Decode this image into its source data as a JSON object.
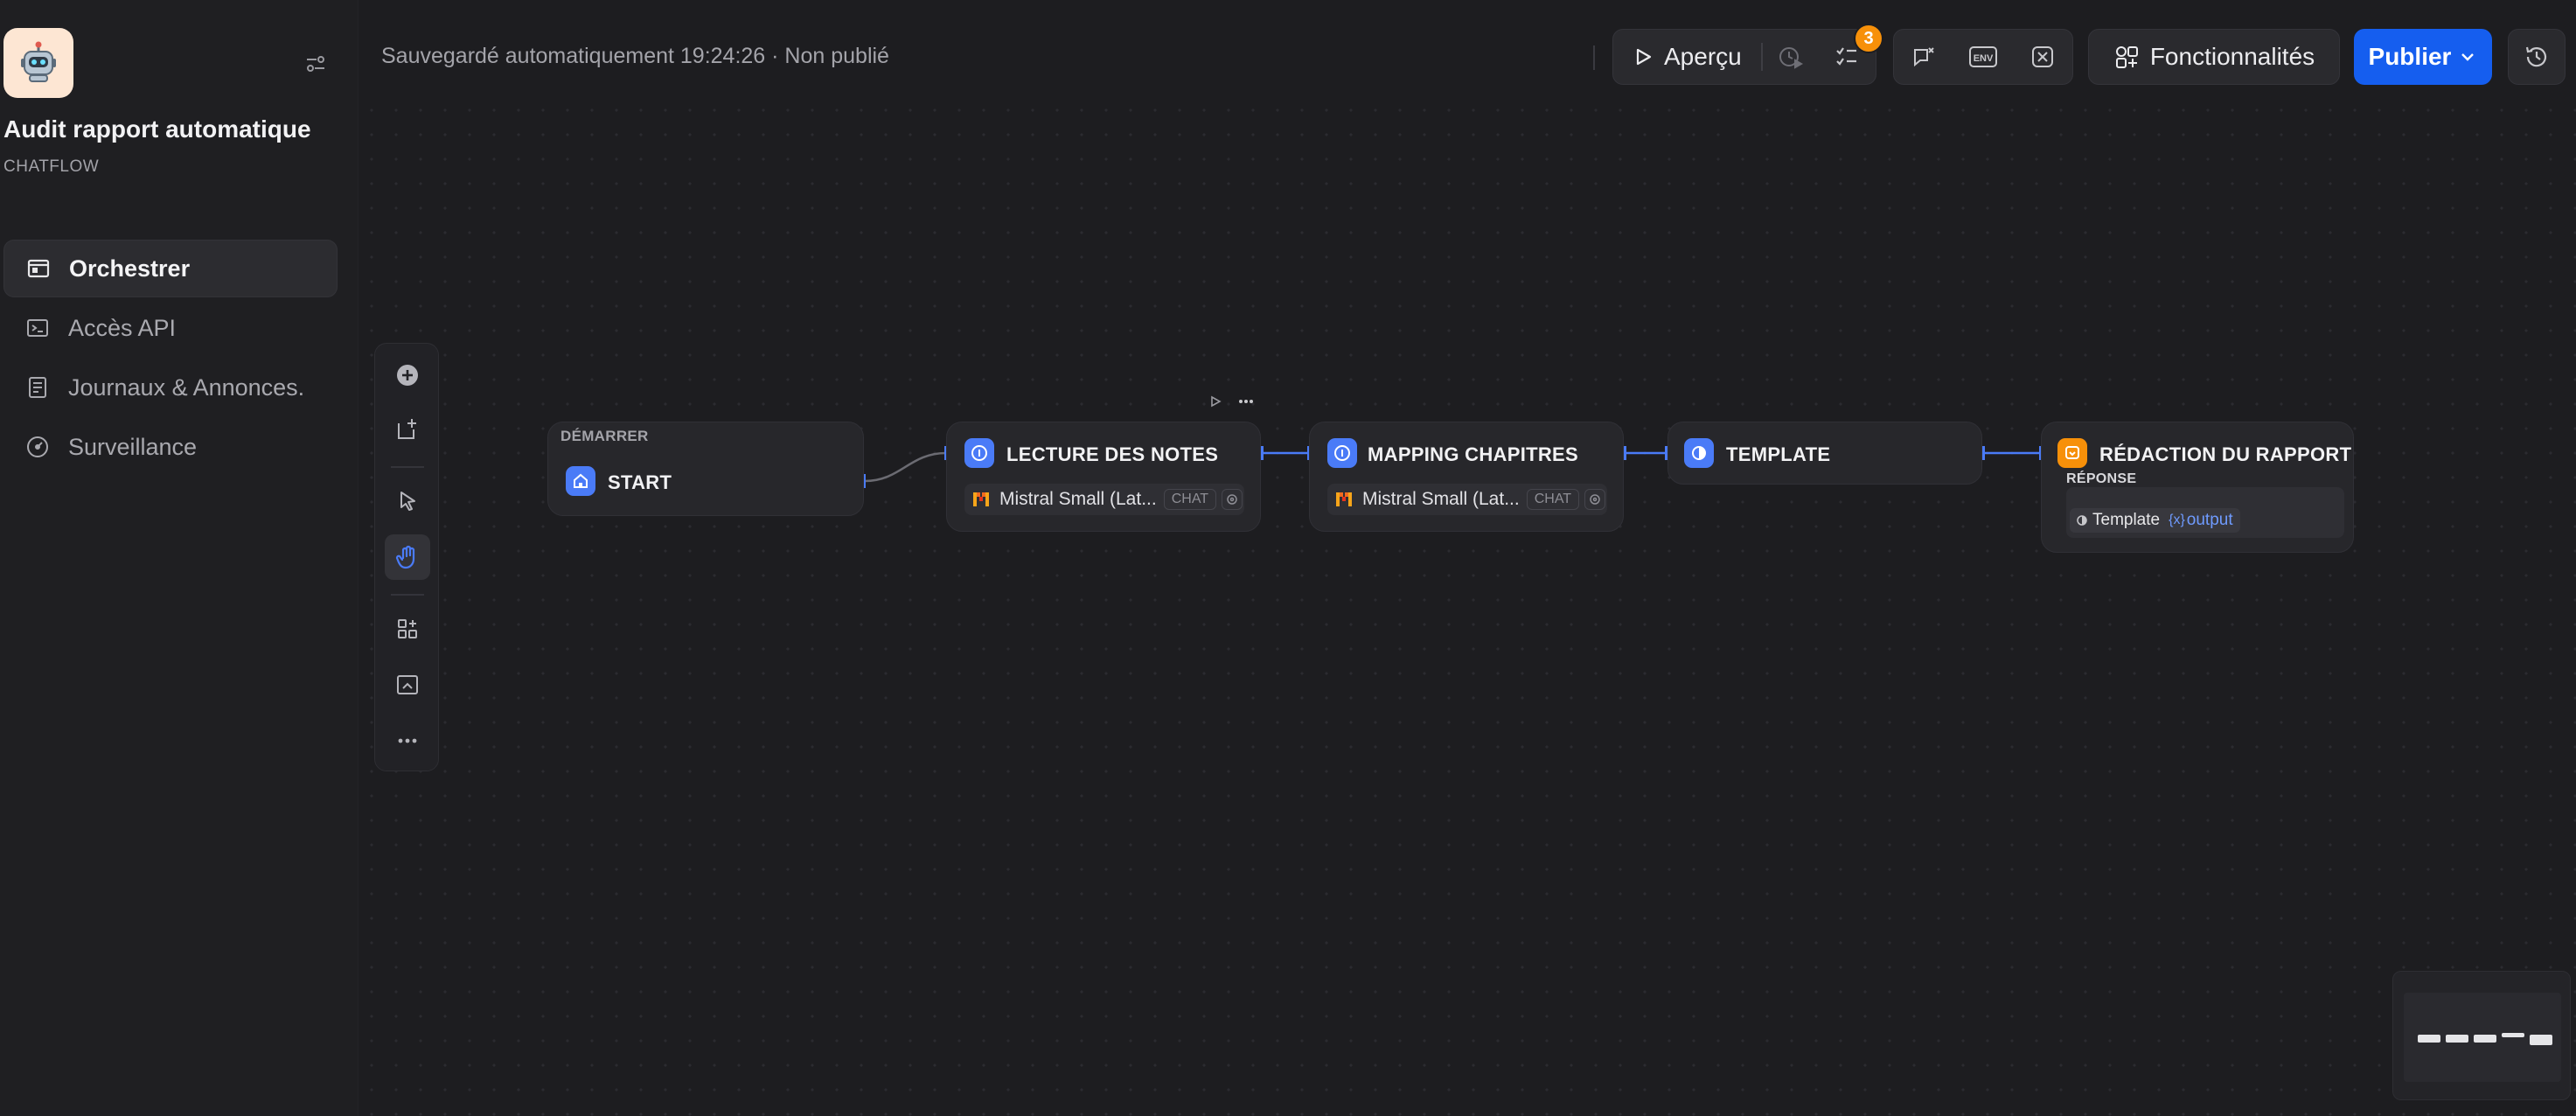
{
  "app": {
    "title": "Audit rapport automatique",
    "type": "CHATFLOW",
    "icon": "robot-icon"
  },
  "sidebar": {
    "items": [
      {
        "label": "Orchestrer",
        "icon": "workflow-icon",
        "active": true
      },
      {
        "label": "Accès API",
        "icon": "terminal-icon",
        "active": false
      },
      {
        "label": "Journaux & Annonces.",
        "icon": "logs-icon",
        "active": false
      },
      {
        "label": "Surveillance",
        "icon": "gauge-icon",
        "active": false
      }
    ]
  },
  "header": {
    "save_status": "Sauvegardé automatiquement 19:24:26 · Non publié",
    "preview_label": "Aperçu",
    "checklist_badge": "3",
    "env_label": "ENV",
    "features_label": "Fonctionnalités",
    "publish_label": "Publier"
  },
  "nodes": {
    "start": {
      "label_small": "DÉMARRER",
      "title": "START"
    },
    "lecture": {
      "title": "LECTURE DES NOTES",
      "model": "Mistral Small (Lat...",
      "mode": "CHAT"
    },
    "mapping": {
      "title": "MAPPING CHAPITRES",
      "model": "Mistral Small (Lat...",
      "mode": "CHAT"
    },
    "template": {
      "title": "TEMPLATE"
    },
    "redaction": {
      "title": "RÉDACTION DU RAPPORT",
      "label_small": "RÉPONSE",
      "var_source": "Template",
      "var_name": "output",
      "var_prefix": "{x}"
    }
  },
  "colors": {
    "accent": "#155eef",
    "llm_node": "#4a7bf7",
    "answer_node": "#f79009",
    "badge": "#f79009"
  }
}
